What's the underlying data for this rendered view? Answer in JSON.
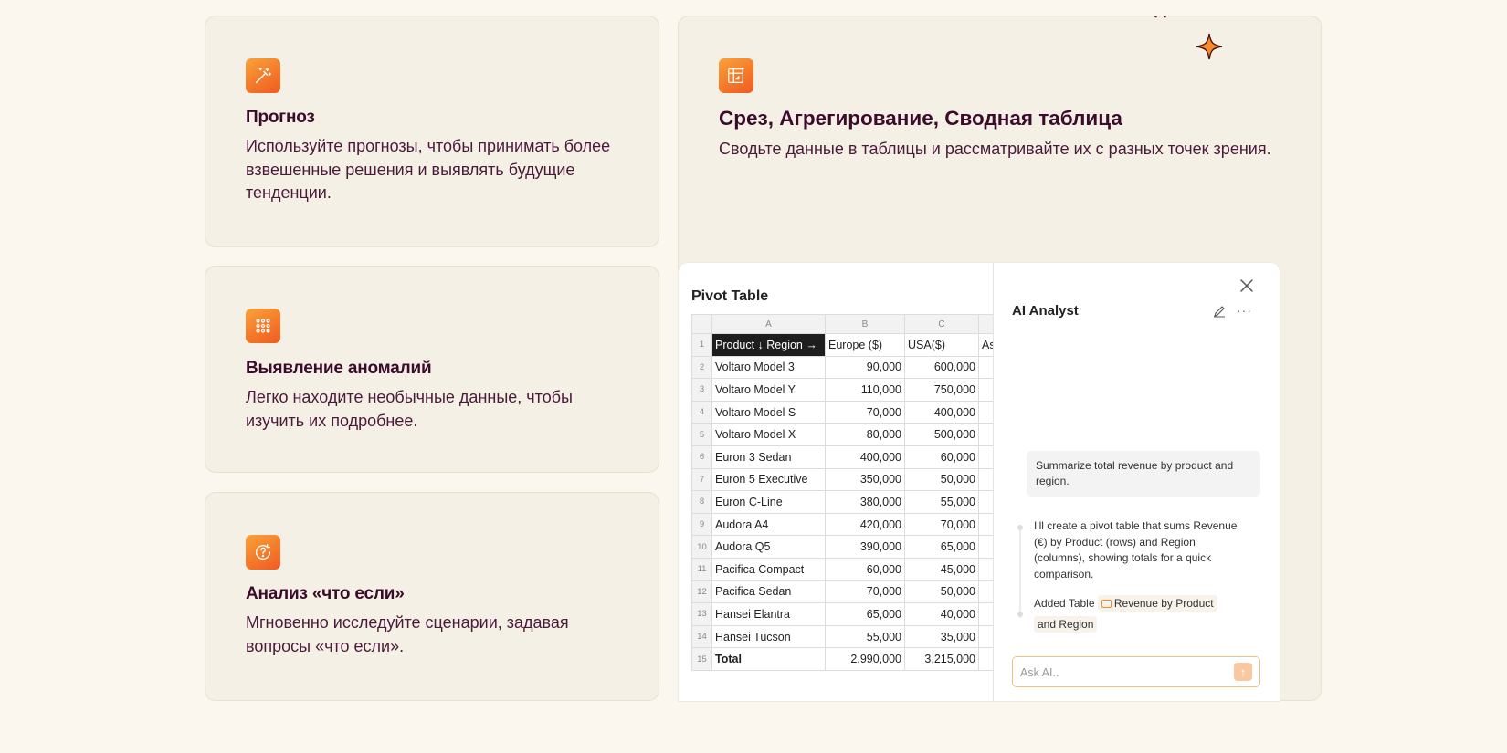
{
  "cards": [
    {
      "icon": "magic-wand-icon",
      "title": "Прогноз",
      "desc": [
        "Используйте прогнозы, чтобы принимать более",
        "взвешенные решения и выявлять будущие",
        "тенденции."
      ]
    },
    {
      "icon": "dots-grid-icon",
      "title": "Выявление аномалий",
      "desc": [
        "Легко находите необычные данные, чтобы",
        "изучить их подробнее."
      ]
    },
    {
      "icon": "question-cycle-icon",
      "title": "Анализ «что если»",
      "desc": [
        "Мгновенно исследуйте сценарии, задавая",
        "вопросы «что если»."
      ]
    }
  ],
  "feature": {
    "icon": "pivot-table-icon",
    "title": "Срез, Агрегирование, Сводная таблица",
    "desc": "Сводьте данные в таблицы и рассматривайте их с разных точек зрения."
  },
  "pivot": {
    "title": "Pivot Table",
    "col_letters": [
      "A",
      "B",
      "C"
    ],
    "headers": [
      "Product ↓ Region →",
      "Europe ($)",
      "USA($)",
      "As"
    ],
    "rows": [
      [
        "2",
        "Voltaro Model 3",
        "90,000",
        "600,000"
      ],
      [
        "3",
        "Voltaro Model Y",
        "110,000",
        "750,000"
      ],
      [
        "4",
        "Voltaro Model S",
        "70,000",
        "400,000"
      ],
      [
        "5",
        "Voltaro Model X",
        "80,000",
        "500,000"
      ],
      [
        "6",
        "Euron 3 Sedan",
        "400,000",
        "60,000"
      ],
      [
        "7",
        "Euron 5 Executive",
        "350,000",
        "50,000"
      ],
      [
        "8",
        "Euron C-Line",
        "380,000",
        "55,000"
      ],
      [
        "9",
        "Audora A4",
        "420,000",
        "70,000"
      ],
      [
        "10",
        "Audora Q5",
        "390,000",
        "65,000"
      ],
      [
        "11",
        "Pacifica Compact",
        "60,000",
        "45,000"
      ],
      [
        "12",
        "Pacifica Sedan",
        "70,000",
        "50,000"
      ],
      [
        "13",
        "Hansei Elantra",
        "65,000",
        "40,000"
      ],
      [
        "14",
        "Hansei Tucson",
        "55,000",
        "35,000"
      ]
    ],
    "total": [
      "15",
      "Total",
      "2,990,000",
      "3,215,000"
    ]
  },
  "ai": {
    "title": "AI Analyst",
    "user_message": "Summarize total revenue by product and region.",
    "reply": "I'll create a pivot table that sums Revenue (€) by Product (rows) and Region (columns), showing totals for a quick comparison.",
    "added_prefix": "Added Table",
    "added_table": "Revenue by Product",
    "added_table_2": "and Region",
    "input_placeholder": "Ask AI..",
    "more": "···"
  },
  "colors": {
    "accent_gradient_start": "#f9a23a",
    "accent_gradient_end": "#ee5a24",
    "title_color": "#3a0b2a",
    "card_bg": "#f5f0e6"
  }
}
